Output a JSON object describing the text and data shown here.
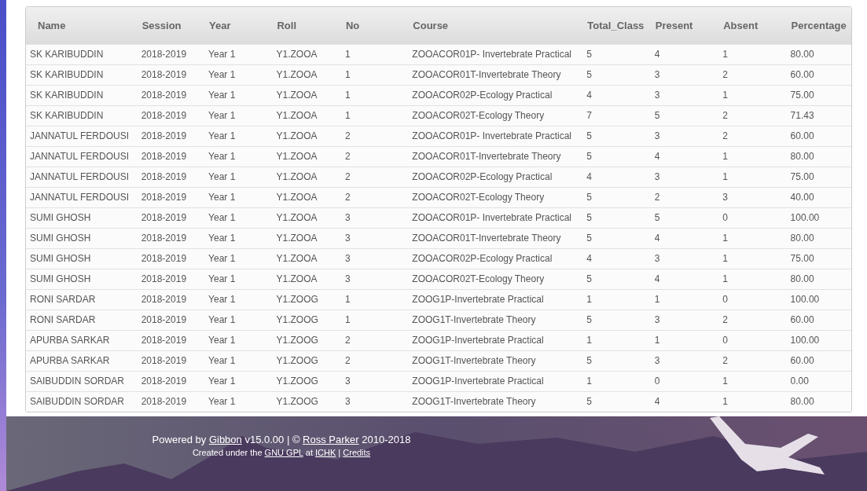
{
  "table": {
    "columns": [
      "Name",
      "Session",
      "Year",
      "Roll",
      "No",
      "Course",
      "Total_Class",
      "Present",
      "Absent",
      "Percentage"
    ],
    "rows": [
      [
        "SK KARIBUDDIN",
        "2018-2019",
        "Year 1",
        "Y1.ZOOA",
        "1",
        "ZOOACOR01P- Invertebrate Practical",
        "5",
        "4",
        "1",
        "80.00"
      ],
      [
        "SK KARIBUDDIN",
        "2018-2019",
        "Year 1",
        "Y1.ZOOA",
        "1",
        "ZOOACOR01T-Invertebrate Theory",
        "5",
        "3",
        "2",
        "60.00"
      ],
      [
        "SK KARIBUDDIN",
        "2018-2019",
        "Year 1",
        "Y1.ZOOA",
        "1",
        "ZOOACOR02P-Ecology Practical",
        "4",
        "3",
        "1",
        "75.00"
      ],
      [
        "SK KARIBUDDIN",
        "2018-2019",
        "Year 1",
        "Y1.ZOOA",
        "1",
        "ZOOACOR02T-Ecology Theory",
        "7",
        "5",
        "2",
        "71.43"
      ],
      [
        "JANNATUL FERDOUSI",
        "2018-2019",
        "Year 1",
        "Y1.ZOOA",
        "2",
        "ZOOACOR01P- Invertebrate Practical",
        "5",
        "3",
        "2",
        "60.00"
      ],
      [
        "JANNATUL FERDOUSI",
        "2018-2019",
        "Year 1",
        "Y1.ZOOA",
        "2",
        "ZOOACOR01T-Invertebrate Theory",
        "5",
        "4",
        "1",
        "80.00"
      ],
      [
        "JANNATUL FERDOUSI",
        "2018-2019",
        "Year 1",
        "Y1.ZOOA",
        "2",
        "ZOOACOR02P-Ecology Practical",
        "4",
        "3",
        "1",
        "75.00"
      ],
      [
        "JANNATUL FERDOUSI",
        "2018-2019",
        "Year 1",
        "Y1.ZOOA",
        "2",
        "ZOOACOR02T-Ecology Theory",
        "5",
        "2",
        "3",
        "40.00"
      ],
      [
        "SUMI GHOSH",
        "2018-2019",
        "Year 1",
        "Y1.ZOOA",
        "3",
        "ZOOACOR01P- Invertebrate Practical",
        "5",
        "5",
        "0",
        "100.00"
      ],
      [
        "SUMI GHOSH",
        "2018-2019",
        "Year 1",
        "Y1.ZOOA",
        "3",
        "ZOOACOR01T-Invertebrate Theory",
        "5",
        "4",
        "1",
        "80.00"
      ],
      [
        "SUMI GHOSH",
        "2018-2019",
        "Year 1",
        "Y1.ZOOA",
        "3",
        "ZOOACOR02P-Ecology Practical",
        "4",
        "3",
        "1",
        "75.00"
      ],
      [
        "SUMI GHOSH",
        "2018-2019",
        "Year 1",
        "Y1.ZOOA",
        "3",
        "ZOOACOR02T-Ecology Theory",
        "5",
        "4",
        "1",
        "80.00"
      ],
      [
        "RONI SARDAR",
        "2018-2019",
        "Year 1",
        "Y1.ZOOG",
        "1",
        "ZOOG1P-Invertebrate Practical",
        "1",
        "1",
        "0",
        "100.00"
      ],
      [
        "RONI SARDAR",
        "2018-2019",
        "Year 1",
        "Y1.ZOOG",
        "1",
        "ZOOG1T-Invertebrate Theory",
        "5",
        "3",
        "2",
        "60.00"
      ],
      [
        "APURBA SARKAR",
        "2018-2019",
        "Year 1",
        "Y1.ZOOG",
        "2",
        "ZOOG1P-Invertebrate Practical",
        "1",
        "1",
        "0",
        "100.00"
      ],
      [
        "APURBA SARKAR",
        "2018-2019",
        "Year 1",
        "Y1.ZOOG",
        "2",
        "ZOOG1T-Invertebrate Theory",
        "5",
        "3",
        "2",
        "60.00"
      ],
      [
        "SAIBUDDIN SORDAR",
        "2018-2019",
        "Year 1",
        "Y1.ZOOG",
        "3",
        "ZOOG1P-Invertebrate Practical",
        "1",
        "0",
        "1",
        "0.00"
      ],
      [
        "SAIBUDDIN SORDAR",
        "2018-2019",
        "Year 1",
        "Y1.ZOOG",
        "3",
        "ZOOG1T-Invertebrate Theory",
        "5",
        "4",
        "1",
        "80.00"
      ]
    ]
  },
  "footer": {
    "lines": [
      [
        {
          "kind": "text",
          "text": "Powered by "
        },
        {
          "kind": "link",
          "text": "Gibbon"
        },
        {
          "kind": "text",
          "text": " v15.0.00 | © "
        },
        {
          "kind": "link",
          "text": "Ross Parker"
        },
        {
          "kind": "text",
          "text": " 2010-2018"
        }
      ],
      [
        {
          "kind": "text",
          "text": "Created under the "
        },
        {
          "kind": "link",
          "text": "GNU GPL"
        },
        {
          "kind": "text",
          "text": " at "
        },
        {
          "kind": "link",
          "text": "ICHK"
        },
        {
          "kind": "text",
          "text": " | "
        },
        {
          "kind": "link",
          "text": "Credits"
        }
      ]
    ]
  }
}
